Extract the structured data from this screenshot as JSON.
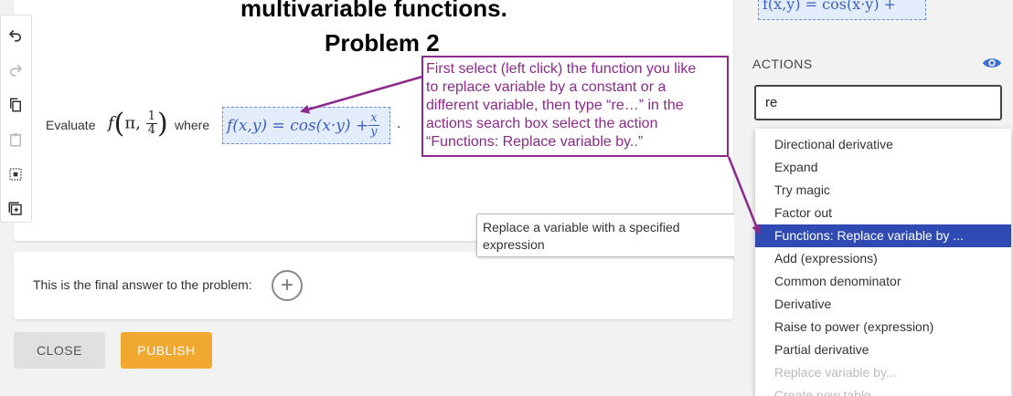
{
  "problem": {
    "title_line1": "multivariable functions.",
    "title_line2": "Problem 2",
    "evaluate_label": "Evaluate",
    "func_name": "f",
    "arg_pi": "π,",
    "arg_frac_num": "1",
    "arg_frac_den": "4",
    "where_label": "where",
    "expr_lhs": "f(x,y) = cos(x·y) + ",
    "expr_frac_num": "x",
    "expr_frac_den": "y",
    "period": "."
  },
  "annotation": {
    "lines": [
      "First select (left click) the function you like",
      "to replace variable by a constant or a",
      "different variable, then type “re…” in the",
      "actions search box    select the action",
      "“Functions: Replace variable by..”"
    ]
  },
  "tooltip": {
    "text": "Replace a variable with a specified expression"
  },
  "answer": {
    "label": "This is the final answer to the problem:",
    "add_symbol": "+"
  },
  "buttons": {
    "close": "CLOSE",
    "publish": "PUBLISH"
  },
  "right_panel": {
    "top_expr": "f(x,y) = cos(x·y) +",
    "actions_label": "ACTIONS",
    "search_value": "re",
    "dropdown_items": [
      "Directional derivative",
      "Expand",
      "Try magic",
      "Factor out",
      "Functions: Replace variable by ...",
      "Add (expressions)",
      "Common denominator",
      "Derivative",
      "Raise to power (expression)",
      "Partial derivative",
      "Replace variable by...",
      "Create new table"
    ],
    "active_index": 4,
    "disabled_indices": [
      10,
      11
    ]
  },
  "colors": {
    "annotation": "#8b2a8b",
    "highlight": "#2f4bb3",
    "publish": "#f0a830",
    "selection": "#3b5fc0"
  },
  "icons": [
    "undo-icon",
    "redo-icon",
    "copy-icon",
    "paste-icon",
    "select-box-icon",
    "add-box-icon",
    "eye-icon"
  ]
}
